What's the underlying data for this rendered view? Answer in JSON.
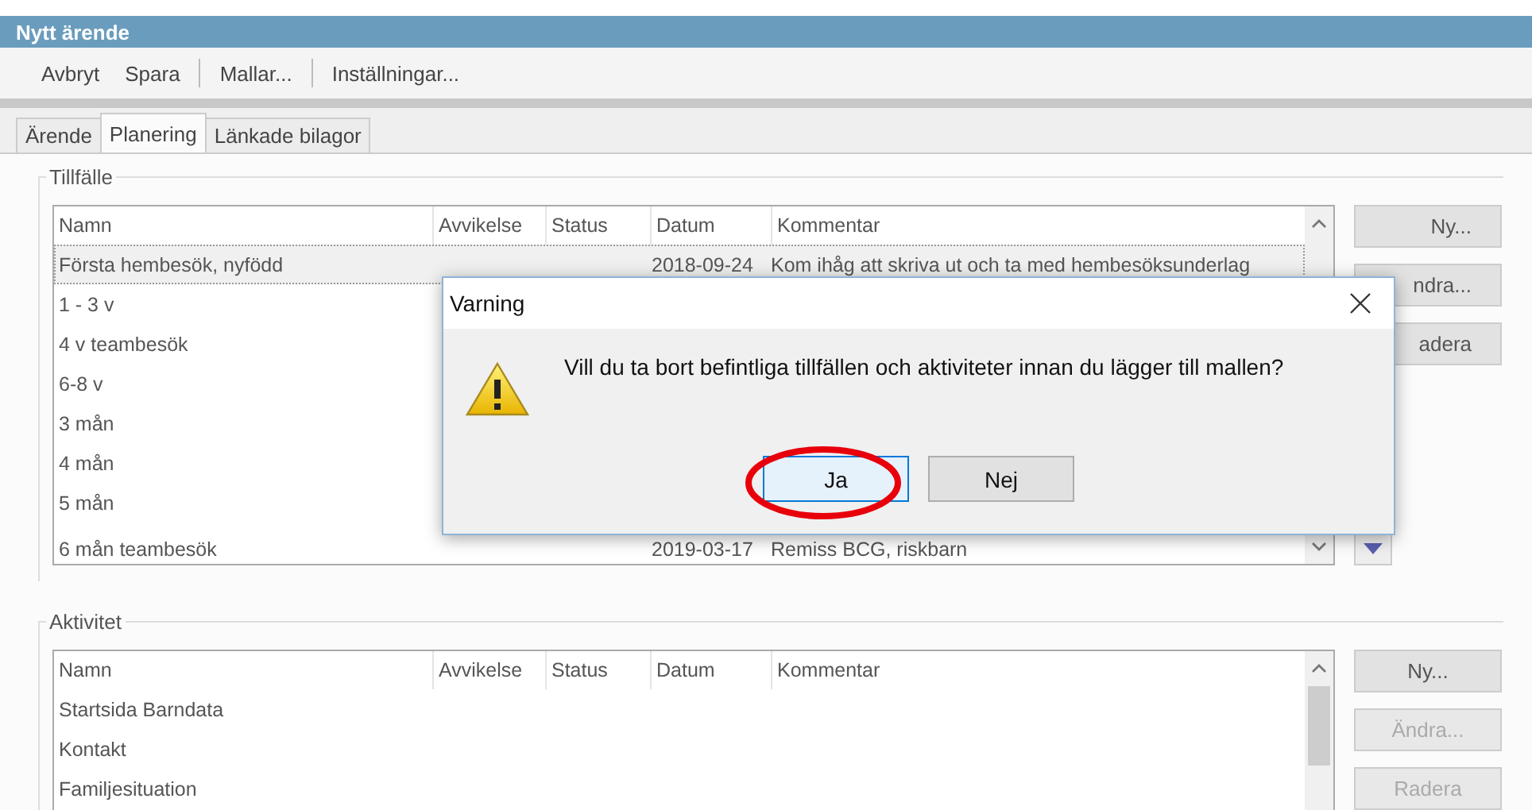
{
  "window": {
    "title": "Nytt ärende"
  },
  "toolbar": [
    {
      "label": "Avbryt",
      "separator_before": false
    },
    {
      "label": "Spara",
      "separator_before": false
    },
    {
      "label": "Mallar...",
      "separator_before": true
    },
    {
      "label": "Inställningar...",
      "separator_before": true
    }
  ],
  "tabs": [
    {
      "label": "Ärende",
      "selected": false
    },
    {
      "label": "Planering",
      "selected": true
    },
    {
      "label": "Länkade bilagor",
      "selected": false
    }
  ],
  "tillfalle": {
    "title": "Tillfälle",
    "columns": [
      "Namn",
      "Avvikelse",
      "Status",
      "Datum",
      "Kommentar"
    ],
    "rows": [
      {
        "name": "Första hembesök, nyfödd",
        "date": "2018-09-24",
        "comment": "Kom ihåg att skriva ut och ta med hembesöksunderlag",
        "selected": true
      },
      {
        "name": "1 - 3 v",
        "selected": false
      },
      {
        "name": "4 v teambesök",
        "selected": false
      },
      {
        "name": "6-8 v",
        "selected": false
      },
      {
        "name": "3 mån",
        "selected": false
      },
      {
        "name": "4 mån",
        "selected": false
      },
      {
        "name": "5 mån",
        "selected": false
      },
      {
        "name": "6 mån teambesök",
        "date": "2019-03-17",
        "comment": "Remiss BCG, riskbarn",
        "selected": false
      }
    ],
    "buttons": [
      {
        "label": "Ny...",
        "disabled": false
      },
      {
        "label": "ndra...",
        "disabled": false
      },
      {
        "label": "adera",
        "disabled": false
      }
    ]
  },
  "aktivitet": {
    "title": "Aktivitet",
    "columns": [
      "Namn",
      "Avvikelse",
      "Status",
      "Datum",
      "Kommentar"
    ],
    "rows": [
      {
        "name": "Startsida Barndata",
        "selected": false
      },
      {
        "name": "Kontakt",
        "selected": false
      },
      {
        "name": "Familjesituation",
        "selected": false
      }
    ],
    "buttons": [
      {
        "label": "Ny...",
        "disabled": false
      },
      {
        "label": "Ändra...",
        "disabled": true
      },
      {
        "label": "Radera",
        "disabled": true
      }
    ]
  },
  "dialog": {
    "title": "Varning",
    "message": "Vill du ta bort befintliga tillfällen och aktiviteter innan du lägger till mallen?",
    "buttons": [
      {
        "label": "Ja",
        "focused": true,
        "circled": true
      },
      {
        "label": "Nej",
        "focused": false,
        "circled": false
      }
    ]
  }
}
